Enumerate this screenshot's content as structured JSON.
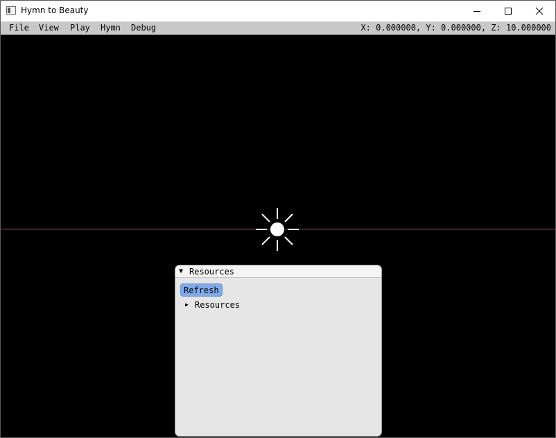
{
  "window": {
    "title": "Hymn to Beauty"
  },
  "menubar": {
    "items": [
      "File",
      "View",
      "Play",
      "Hymn",
      "Debug"
    ],
    "coordinates": "X: 0.000000, Y: 0.000000, Z: 10.000000"
  },
  "resources_panel": {
    "title": "Resources",
    "refresh_label": "Refresh",
    "tree_items": [
      "Resources"
    ]
  },
  "colors": {
    "horizon_line": "#a05a64",
    "refresh_button": "#7fa9e8",
    "panel_bg": "#e6e6e6",
    "menubar_bg": "#c8c8c8"
  },
  "icons": {
    "scene_light": "sun-icon"
  }
}
